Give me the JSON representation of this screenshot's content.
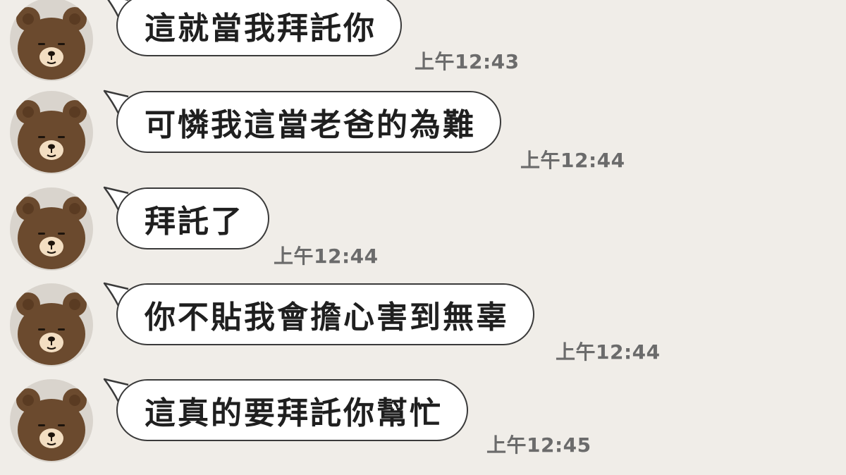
{
  "messages": [
    {
      "text": "這就當我拜託你",
      "time": "上午12:43"
    },
    {
      "text": "可憐我這當老爸的為難",
      "time": "上午12:44"
    },
    {
      "text": "拜託了",
      "time": "上午12:44"
    },
    {
      "text": "你不貼我會擔心害到無辜",
      "time": "上午12:44"
    },
    {
      "text": "這真的要拜託你幫忙",
      "time": "上午12:45"
    }
  ],
  "avatar_icon": "brown-bear-icon",
  "colors": {
    "background": "#f0ede8",
    "bubble": "#ffffff",
    "bubble_border": "#3a3a3a",
    "time_text": "#6b6b6b",
    "bear_fur": "#6b4a2e",
    "bear_muzzle": "#f3dec2"
  }
}
